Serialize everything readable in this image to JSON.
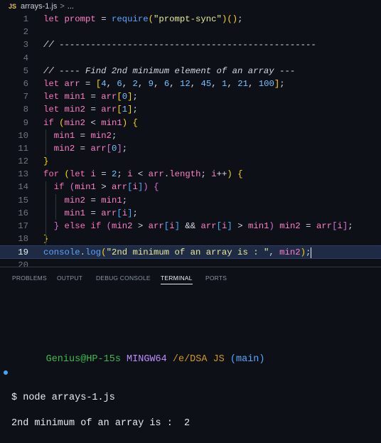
{
  "breadcrumb": {
    "badge": "JS",
    "file": "arrays-1.js",
    "sep": ">",
    "ellipsis": "..."
  },
  "editor": {
    "lines": [
      {
        "n": "1",
        "t": [
          [
            "kw",
            "let"
          ],
          [
            "pl",
            " "
          ],
          [
            "va",
            "prompt"
          ],
          [
            "pl",
            " = "
          ],
          [
            "fn",
            "require"
          ],
          [
            "b1",
            "("
          ],
          [
            "st",
            "\"prompt-sync\""
          ],
          [
            "b1",
            ")"
          ],
          [
            "b1",
            "("
          ],
          [
            "b1",
            ")"
          ],
          [
            "pl",
            ";"
          ]
        ]
      },
      {
        "n": "2",
        "t": []
      },
      {
        "n": "3",
        "t": [
          [
            "cm",
            "// -------------------------------------------------"
          ]
        ]
      },
      {
        "n": "4",
        "t": []
      },
      {
        "n": "5",
        "t": [
          [
            "cm",
            "// ---- Find 2nd minimum element of an array ---"
          ]
        ]
      },
      {
        "n": "6",
        "t": [
          [
            "kw",
            "let"
          ],
          [
            "pl",
            " "
          ],
          [
            "va",
            "arr"
          ],
          [
            "pl",
            " = "
          ],
          [
            "b1",
            "["
          ],
          [
            "nu",
            "4"
          ],
          [
            "pl",
            ", "
          ],
          [
            "nu",
            "6"
          ],
          [
            "pl",
            ", "
          ],
          [
            "nu",
            "2"
          ],
          [
            "pl",
            ", "
          ],
          [
            "nu",
            "9"
          ],
          [
            "pl",
            ", "
          ],
          [
            "nu",
            "6"
          ],
          [
            "pl",
            ", "
          ],
          [
            "nu",
            "12"
          ],
          [
            "pl",
            ", "
          ],
          [
            "nu",
            "45"
          ],
          [
            "pl",
            ", "
          ],
          [
            "nu",
            "1"
          ],
          [
            "pl",
            ", "
          ],
          [
            "nu",
            "21"
          ],
          [
            "pl",
            ", "
          ],
          [
            "nu",
            "100"
          ],
          [
            "b1",
            "]"
          ],
          [
            "pl",
            ";"
          ]
        ]
      },
      {
        "n": "7",
        "t": [
          [
            "kw",
            "let"
          ],
          [
            "pl",
            " "
          ],
          [
            "va",
            "min1"
          ],
          [
            "pl",
            " = "
          ],
          [
            "va",
            "arr"
          ],
          [
            "b1",
            "["
          ],
          [
            "nu",
            "0"
          ],
          [
            "b1",
            "]"
          ],
          [
            "pl",
            ";"
          ]
        ]
      },
      {
        "n": "8",
        "t": [
          [
            "kw",
            "let"
          ],
          [
            "pl",
            " "
          ],
          [
            "va",
            "min2"
          ],
          [
            "pl",
            " = "
          ],
          [
            "va",
            "arr"
          ],
          [
            "b1",
            "["
          ],
          [
            "nu",
            "1"
          ],
          [
            "b1",
            "]"
          ],
          [
            "pl",
            ";"
          ]
        ]
      },
      {
        "n": "9",
        "t": [
          [
            "kw",
            "if"
          ],
          [
            "pl",
            " "
          ],
          [
            "b1",
            "("
          ],
          [
            "va",
            "min2"
          ],
          [
            "pl",
            " < "
          ],
          [
            "va",
            "min1"
          ],
          [
            "b1",
            ")"
          ],
          [
            "pl",
            " "
          ],
          [
            "b1",
            "{"
          ]
        ]
      },
      {
        "n": "10",
        "t": [
          [
            "pl",
            "  "
          ],
          [
            "va",
            "min1"
          ],
          [
            "pl",
            " = "
          ],
          [
            "va",
            "min2"
          ],
          [
            "pl",
            ";"
          ]
        ]
      },
      {
        "n": "11",
        "t": [
          [
            "pl",
            "  "
          ],
          [
            "va",
            "min2"
          ],
          [
            "pl",
            " = "
          ],
          [
            "va",
            "arr"
          ],
          [
            "b2",
            "["
          ],
          [
            "nu",
            "0"
          ],
          [
            "b2",
            "]"
          ],
          [
            "pl",
            ";"
          ]
        ]
      },
      {
        "n": "12",
        "t": [
          [
            "b1",
            "}"
          ]
        ]
      },
      {
        "n": "13",
        "t": [
          [
            "kw",
            "for"
          ],
          [
            "pl",
            " "
          ],
          [
            "b1",
            "("
          ],
          [
            "kw",
            "let"
          ],
          [
            "pl",
            " "
          ],
          [
            "va",
            "i"
          ],
          [
            "pl",
            " = "
          ],
          [
            "nu",
            "2"
          ],
          [
            "pl",
            "; "
          ],
          [
            "va",
            "i"
          ],
          [
            "pl",
            " < "
          ],
          [
            "va",
            "arr"
          ],
          [
            "pl",
            "."
          ],
          [
            "va",
            "length"
          ],
          [
            "pl",
            "; "
          ],
          [
            "va",
            "i"
          ],
          [
            "pl",
            "++"
          ],
          [
            "b1",
            ")"
          ],
          [
            "pl",
            " "
          ],
          [
            "b1",
            "{"
          ]
        ]
      },
      {
        "n": "14",
        "t": [
          [
            "pl",
            "  "
          ],
          [
            "kw",
            "if"
          ],
          [
            "pl",
            " "
          ],
          [
            "b2",
            "("
          ],
          [
            "va",
            "min1"
          ],
          [
            "pl",
            " > "
          ],
          [
            "va",
            "arr"
          ],
          [
            "b3",
            "["
          ],
          [
            "va",
            "i"
          ],
          [
            "b3",
            "]"
          ],
          [
            "b2",
            ")"
          ],
          [
            "pl",
            " "
          ],
          [
            "b2",
            "{"
          ]
        ]
      },
      {
        "n": "15",
        "t": [
          [
            "pl",
            "    "
          ],
          [
            "va",
            "min2"
          ],
          [
            "pl",
            " = "
          ],
          [
            "va",
            "min1"
          ],
          [
            "pl",
            ";"
          ]
        ]
      },
      {
        "n": "16",
        "t": [
          [
            "pl",
            "    "
          ],
          [
            "va",
            "min1"
          ],
          [
            "pl",
            " = "
          ],
          [
            "va",
            "arr"
          ],
          [
            "b3",
            "["
          ],
          [
            "va",
            "i"
          ],
          [
            "b3",
            "]"
          ],
          [
            "pl",
            ";"
          ]
        ]
      },
      {
        "n": "17",
        "t": [
          [
            "pl",
            "  "
          ],
          [
            "b2",
            "}"
          ],
          [
            "pl",
            " "
          ],
          [
            "kw",
            "else if"
          ],
          [
            "pl",
            " "
          ],
          [
            "b2",
            "("
          ],
          [
            "va",
            "min2"
          ],
          [
            "pl",
            " > "
          ],
          [
            "va",
            "arr"
          ],
          [
            "b3",
            "["
          ],
          [
            "va",
            "i"
          ],
          [
            "b3",
            "]"
          ],
          [
            "pl",
            " && "
          ],
          [
            "va",
            "arr"
          ],
          [
            "b3",
            "["
          ],
          [
            "va",
            "i"
          ],
          [
            "b3",
            "]"
          ],
          [
            "pl",
            " > "
          ],
          [
            "va",
            "min1"
          ],
          [
            "b2",
            ")"
          ],
          [
            "pl",
            " "
          ],
          [
            "va",
            "min2"
          ],
          [
            "pl",
            " = "
          ],
          [
            "va",
            "arr"
          ],
          [
            "b2",
            "["
          ],
          [
            "va",
            "i"
          ],
          [
            "b2",
            "]"
          ],
          [
            "pl",
            ";"
          ]
        ]
      },
      {
        "n": "18",
        "t": [
          [
            "b1",
            "}"
          ]
        ]
      },
      {
        "n": "19",
        "t": [
          [
            "fn",
            "console"
          ],
          [
            "pl",
            "."
          ],
          [
            "fn",
            "log"
          ],
          [
            "b1",
            "("
          ],
          [
            "st",
            "\"2nd minimum of an array is : \""
          ],
          [
            "pl",
            ", "
          ],
          [
            "va",
            "min2"
          ],
          [
            "b1",
            ")"
          ],
          [
            "pl",
            ";"
          ]
        ]
      },
      {
        "n": "20",
        "t": []
      }
    ]
  },
  "panel": {
    "tabs": [
      "PROBLEMS",
      "OUTPUT",
      "DEBUG CONSOLE",
      "TERMINAL",
      "PORTS"
    ],
    "active_tab": "TERMINAL"
  },
  "terminal": {
    "user": "Genius@HP-15s",
    "host": "MINGW64",
    "path": "/e/DSA JS",
    "branch": "(main)",
    "prompt": "$",
    "command": "node arrays-1.js",
    "output": "2nd minimum of an array is :  2"
  },
  "colors": {
    "editor_bg": "#0d1117",
    "keyword": "#ff6fbb",
    "function": "#58a6ff",
    "string": "#e6ec9a",
    "number": "#79c0ff",
    "active_line": "#1f2a44"
  }
}
